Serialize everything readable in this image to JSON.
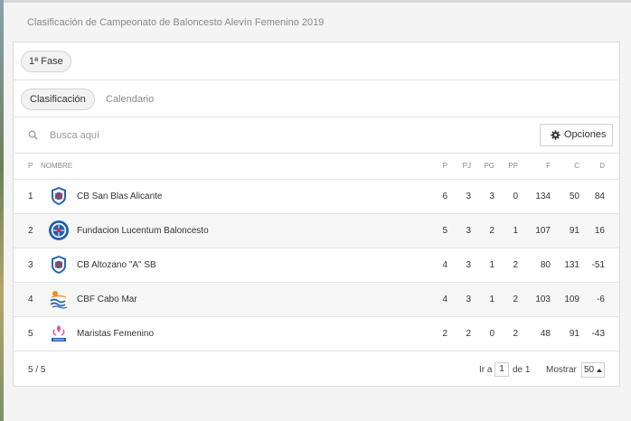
{
  "header": {
    "title": "Clasificación de Campeonato de Baloncesto Alevín Femenino 2019"
  },
  "phase": {
    "label": "1ª Fase"
  },
  "tabs": [
    {
      "label": "Clasificación",
      "active": true
    },
    {
      "label": "Calendario",
      "active": false
    }
  ],
  "search": {
    "placeholder": "Busca aquí",
    "value": ""
  },
  "options_button": {
    "label": "Opciones",
    "icon": "gear-icon"
  },
  "table": {
    "columns": [
      "P",
      "NOMBRE",
      "P",
      "PJ",
      "PG",
      "PP",
      "F",
      "C",
      "D"
    ],
    "rows": [
      {
        "pos": "1",
        "team": "CB San Blas Alicante",
        "logo": "san-blas-logo",
        "p": "6",
        "pj": "3",
        "pg": "3",
        "pp": "0",
        "f": "134",
        "c": "50",
        "d": "84"
      },
      {
        "pos": "2",
        "team": "Fundacion Lucentum Baloncesto",
        "logo": "lucentum-logo",
        "p": "5",
        "pj": "3",
        "pg": "2",
        "pp": "1",
        "f": "107",
        "c": "91",
        "d": "16"
      },
      {
        "pos": "3",
        "team": "CB Altozano \"A\" SB",
        "logo": "altozano-logo",
        "p": "4",
        "pj": "3",
        "pg": "1",
        "pp": "2",
        "f": "80",
        "c": "131",
        "d": "-51"
      },
      {
        "pos": "4",
        "team": "CBF Cabo Mar",
        "logo": "cabo-mar-logo",
        "p": "4",
        "pj": "3",
        "pg": "1",
        "pp": "2",
        "f": "103",
        "c": "109",
        "d": "-6"
      },
      {
        "pos": "5",
        "team": "Maristas Femenino",
        "logo": "maristas-logo",
        "p": "2",
        "pj": "2",
        "pg": "0",
        "pp": "2",
        "f": "48",
        "c": "91",
        "d": "-43"
      }
    ]
  },
  "footer": {
    "count": "5 / 5",
    "goto_label": "Ir a",
    "page_value": "1",
    "of_label": "de 1",
    "show_label": "Mostrar",
    "per_page": "50"
  }
}
